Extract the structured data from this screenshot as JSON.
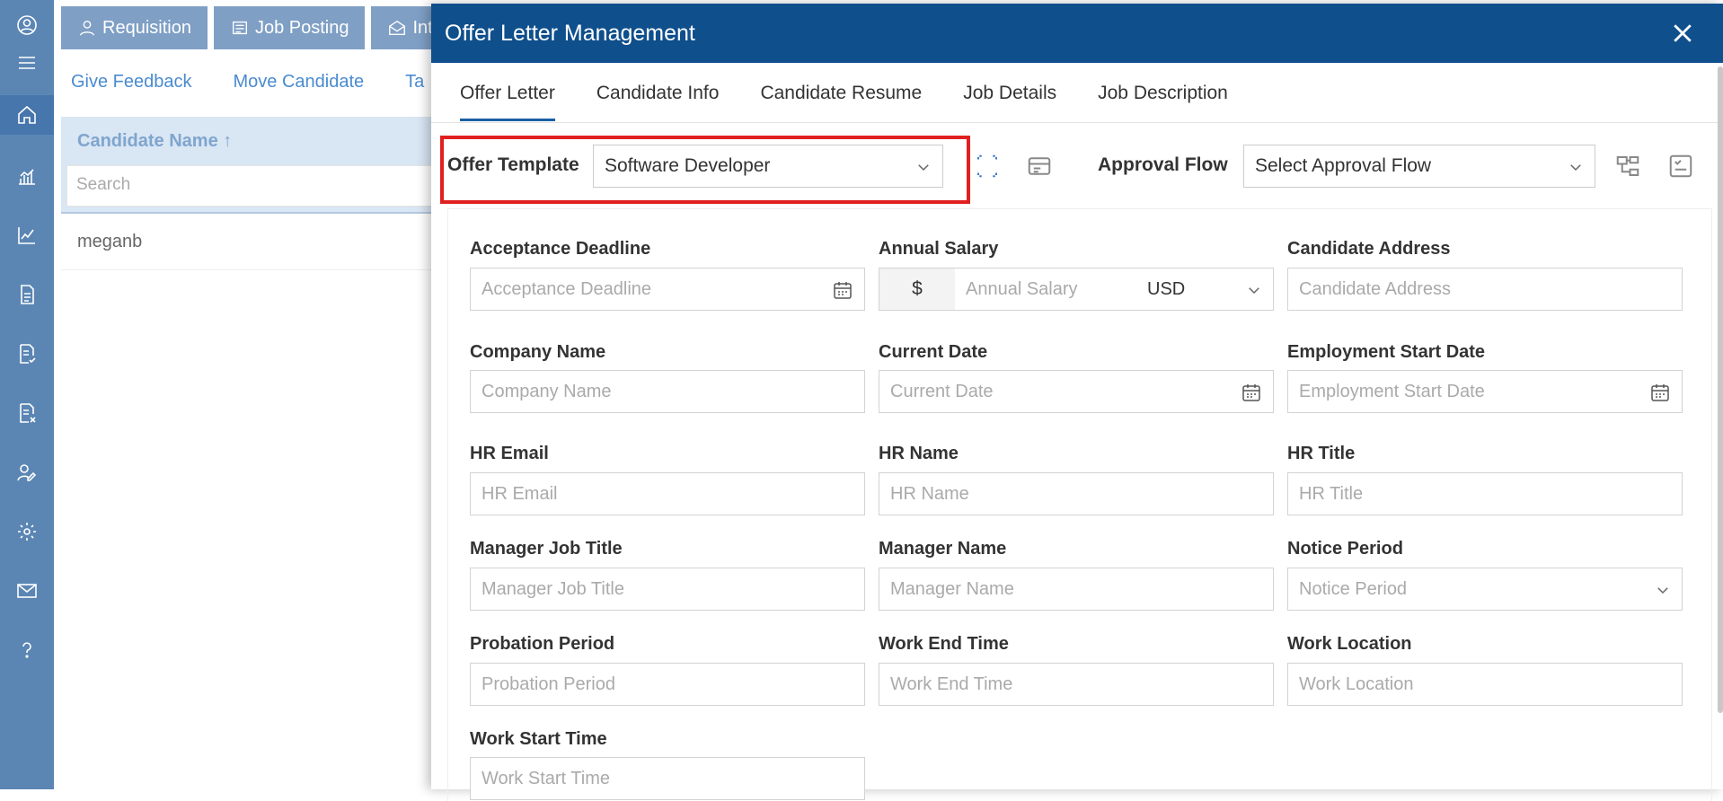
{
  "background": {
    "top_tabs": [
      "Requisition",
      "Job Posting",
      "Int"
    ],
    "actions": [
      "Give Feedback",
      "Move Candidate",
      "Ta"
    ],
    "grid": {
      "column_header": "Candidate Name ↑",
      "search_placeholder": "Search",
      "rows": [
        "meganb"
      ]
    }
  },
  "dialog": {
    "title": "Offer Letter Management",
    "tabs": [
      "Offer Letter",
      "Candidate Info",
      "Candidate Resume",
      "Job Details",
      "Job Description"
    ],
    "active_tab": "Offer Letter",
    "offer_template": {
      "label": "Offer Template",
      "value": "Software Developer"
    },
    "approval_flow": {
      "label": "Approval Flow",
      "value": "Select Approval Flow"
    },
    "fields": [
      {
        "label": "Acceptance Deadline",
        "placeholder": "Acceptance Deadline",
        "kind": "date"
      },
      {
        "label": "Annual Salary",
        "placeholder": "Annual Salary",
        "kind": "salary",
        "prefix": "$",
        "currency": "USD"
      },
      {
        "label": "Candidate Address",
        "placeholder": "Candidate Address",
        "kind": "text"
      },
      {
        "label": "Company Name",
        "placeholder": "Company Name",
        "kind": "text"
      },
      {
        "label": "Current Date",
        "placeholder": "Current Date",
        "kind": "date"
      },
      {
        "label": "Employment Start Date",
        "placeholder": "Employment Start Date",
        "kind": "date"
      },
      {
        "label": "HR Email",
        "placeholder": "HR Email",
        "kind": "text"
      },
      {
        "label": "HR Name",
        "placeholder": "HR Name",
        "kind": "text"
      },
      {
        "label": "HR Title",
        "placeholder": "HR Title",
        "kind": "text"
      },
      {
        "label": "Manager Job Title",
        "placeholder": "Manager Job Title",
        "kind": "text"
      },
      {
        "label": "Manager Name",
        "placeholder": "Manager Name",
        "kind": "text"
      },
      {
        "label": "Notice Period",
        "placeholder": "Notice Period",
        "kind": "select"
      },
      {
        "label": "Probation Period",
        "placeholder": "Probation Period",
        "kind": "text"
      },
      {
        "label": "Work End Time",
        "placeholder": "Work End Time",
        "kind": "text"
      },
      {
        "label": "Work Location",
        "placeholder": "Work Location",
        "kind": "text"
      },
      {
        "label": "Work Start Time",
        "placeholder": "Work Start Time",
        "kind": "text"
      }
    ]
  },
  "icons": {
    "rail": [
      "user-icon",
      "menu-icon",
      "home-icon",
      "analytics-icon",
      "chart-icon",
      "document-icon",
      "checklist-icon",
      "reject-doc-icon",
      "user-edit-icon",
      "gear-icon",
      "mail-icon",
      "help-icon"
    ]
  },
  "colors": {
    "header": "#0f4f8c",
    "rail": "#5b86b4",
    "highlight": "#e02020",
    "link": "#4a8bd0"
  }
}
